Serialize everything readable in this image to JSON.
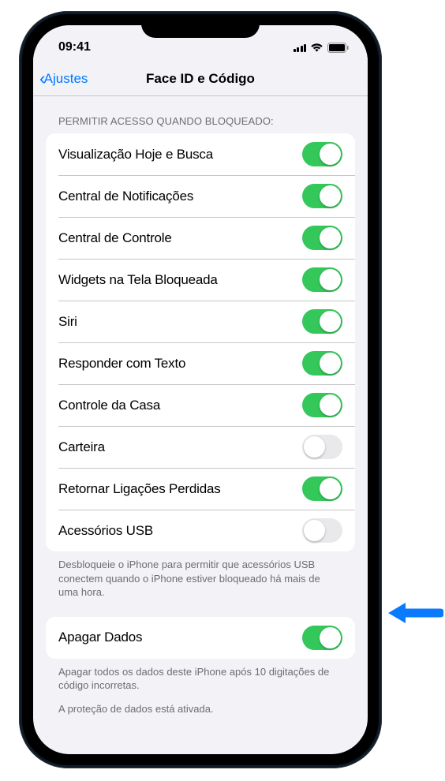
{
  "status": {
    "time": "09:41"
  },
  "nav": {
    "back": "Ajustes",
    "title": "Face ID e Código"
  },
  "section1": {
    "header": "PERMITIR ACESSO QUANDO BLOQUEADO:",
    "items": [
      {
        "label": "Visualização Hoje e Busca",
        "on": true
      },
      {
        "label": "Central de Notificações",
        "on": true
      },
      {
        "label": "Central de Controle",
        "on": true
      },
      {
        "label": "Widgets na Tela Bloqueada",
        "on": true
      },
      {
        "label": "Siri",
        "on": true
      },
      {
        "label": "Responder com Texto",
        "on": true
      },
      {
        "label": "Controle da Casa",
        "on": true
      },
      {
        "label": "Carteira",
        "on": false
      },
      {
        "label": "Retornar Ligações Perdidas",
        "on": true
      },
      {
        "label": "Acessórios USB",
        "on": false
      }
    ],
    "footer": "Desbloqueie o iPhone para permitir que acessórios USB conectem quando o iPhone estiver bloqueado há mais de uma hora."
  },
  "section2": {
    "item": {
      "label": "Apagar Dados",
      "on": true
    },
    "footer1": "Apagar todos os dados deste iPhone após 10 digitações de código incorretas.",
    "footer2": "A proteção de dados está ativada."
  }
}
